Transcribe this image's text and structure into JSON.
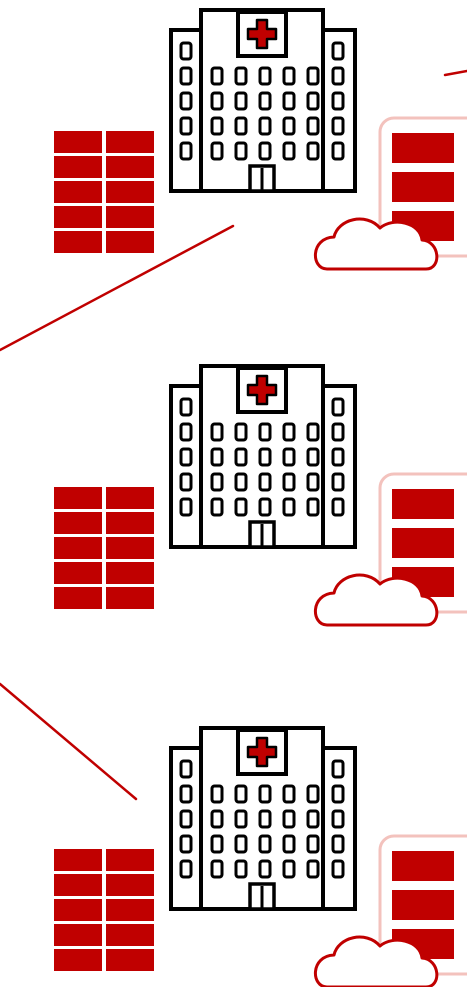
{
  "colors": {
    "accent": "#c00000",
    "outline": "#000000",
    "server_border": "#f3c2bd",
    "cloud_stroke": "#c00000",
    "background": "#ffffff"
  },
  "groups": [
    {
      "building_icon": "hospital-building-icon",
      "firewall_icon": "firewall-brick-icon",
      "server_icon": "server-rack-icon",
      "cloud_icon": "cloud-icon",
      "server_units": 3,
      "brick_rows": 5
    },
    {
      "building_icon": "hospital-building-icon",
      "firewall_icon": "firewall-brick-icon",
      "server_icon": "server-rack-icon",
      "cloud_icon": "cloud-icon",
      "server_units": 3,
      "brick_rows": 5
    },
    {
      "building_icon": "hospital-building-icon",
      "firewall_icon": "firewall-brick-icon",
      "server_icon": "server-rack-icon",
      "cloud_icon": "cloud-icon",
      "server_units": 3,
      "brick_rows": 5
    }
  ],
  "connectors": [
    {
      "from": "hospital-1",
      "to": "offscreen-left"
    },
    {
      "from": "offscreen-top-right",
      "to": "offscreen-right"
    },
    {
      "from": "offscreen-left",
      "to": "hospital-3"
    }
  ]
}
